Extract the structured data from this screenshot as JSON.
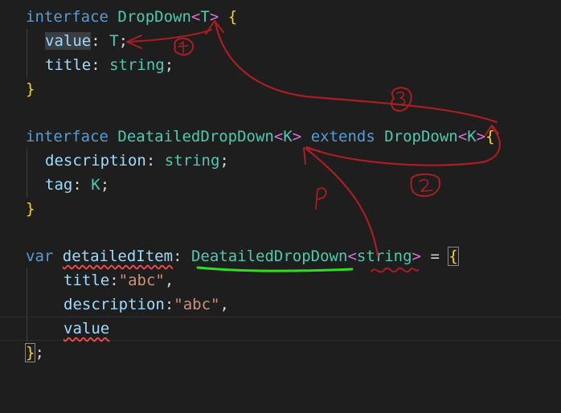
{
  "code": {
    "l1": {
      "kw": "interface",
      "name": "DropDown",
      "open": "<",
      "param": "T",
      "close": ">",
      "brace": "{"
    },
    "l2": {
      "prop": "value",
      "colon": ":",
      "type": "T",
      "semi": ";"
    },
    "l3": {
      "prop": "title",
      "colon": ":",
      "type": "string",
      "semi": ";"
    },
    "l4": {
      "brace": "}"
    },
    "l6": {
      "kw": "interface",
      "name": "DeatailedDropDown",
      "open": "<",
      "param": "K",
      "close": ">",
      "kw2": "extends",
      "base": "DropDown",
      "open2": "<",
      "param2": "K",
      "close2": ">",
      "brace": "{"
    },
    "l7": {
      "prop": "description",
      "colon": ":",
      "type": "string",
      "semi": ";"
    },
    "l8": {
      "prop": "tag",
      "colon": ":",
      "type": "K",
      "semi": ";"
    },
    "l9": {
      "brace": "}"
    },
    "l11": {
      "kw": "var",
      "name": "detailedItem",
      "colon": ":",
      "type": "DeatailedDropDown",
      "open": "<",
      "targ": "string",
      "close": ">",
      "eq": "=",
      "brace": "{"
    },
    "l12": {
      "prop": "title",
      "colon": ":",
      "value": "\"abc\"",
      "comma": ","
    },
    "l13": {
      "prop": "description",
      "colon": ":",
      "value": "\"abc\"",
      "comma": ","
    },
    "l14": {
      "prop": "value"
    },
    "l15": {
      "brace": "}",
      "semi": ";"
    }
  },
  "annotations": {
    "stroke_color": "#a81e22",
    "underline_color": "#2ee01f",
    "labels": [
      "①",
      "②",
      "③",
      "P"
    ]
  }
}
